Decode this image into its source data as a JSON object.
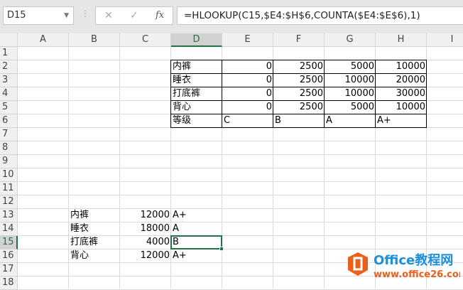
{
  "name_box": "D15",
  "formula_icons": [
    "cancel-icon",
    "enter-icon",
    "function-icon"
  ],
  "formula": "=HLOOKUP(C15,$E4:$H$6,COUNTA($E4:$E$6),1)",
  "columns": [
    "A",
    "B",
    "C",
    "D",
    "E",
    "F",
    "G",
    "H",
    "I"
  ],
  "rows": [
    "1",
    "2",
    "3",
    "4",
    "5",
    "6",
    "7",
    "8",
    "9",
    "10",
    "11",
    "12",
    "13",
    "14",
    "15",
    "16",
    "17",
    "18"
  ],
  "lookup_table": [
    {
      "row": 2,
      "cells": [
        "内裤",
        "0",
        "2500",
        "5000",
        "10000"
      ]
    },
    {
      "row": 3,
      "cells": [
        "睡衣",
        "0",
        "2500",
        "10000",
        "20000"
      ]
    },
    {
      "row": 4,
      "cells": [
        "打底裤",
        "0",
        "2500",
        "10000",
        "30000"
      ]
    },
    {
      "row": 5,
      "cells": [
        "背心",
        "0",
        "2500",
        "5000",
        "10000"
      ]
    },
    {
      "row": 6,
      "cells": [
        "等级",
        "C",
        "B",
        "A",
        "A+"
      ]
    }
  ],
  "results": [
    {
      "row": 13,
      "cells": [
        "内裤",
        "12000",
        "A+"
      ]
    },
    {
      "row": 14,
      "cells": [
        "睡衣",
        "18000",
        "A"
      ]
    },
    {
      "row": 15,
      "cells": [
        "打底裤",
        "4000",
        "B"
      ]
    },
    {
      "row": 16,
      "cells": [
        "背心",
        "12000",
        "A+"
      ]
    }
  ],
  "selected_cell": "D15",
  "watermark": {
    "title": "Office教程网",
    "url": "www.office26.com",
    "colors": {
      "brand": "#e8601c",
      "blue": "#1e8fd8"
    }
  }
}
